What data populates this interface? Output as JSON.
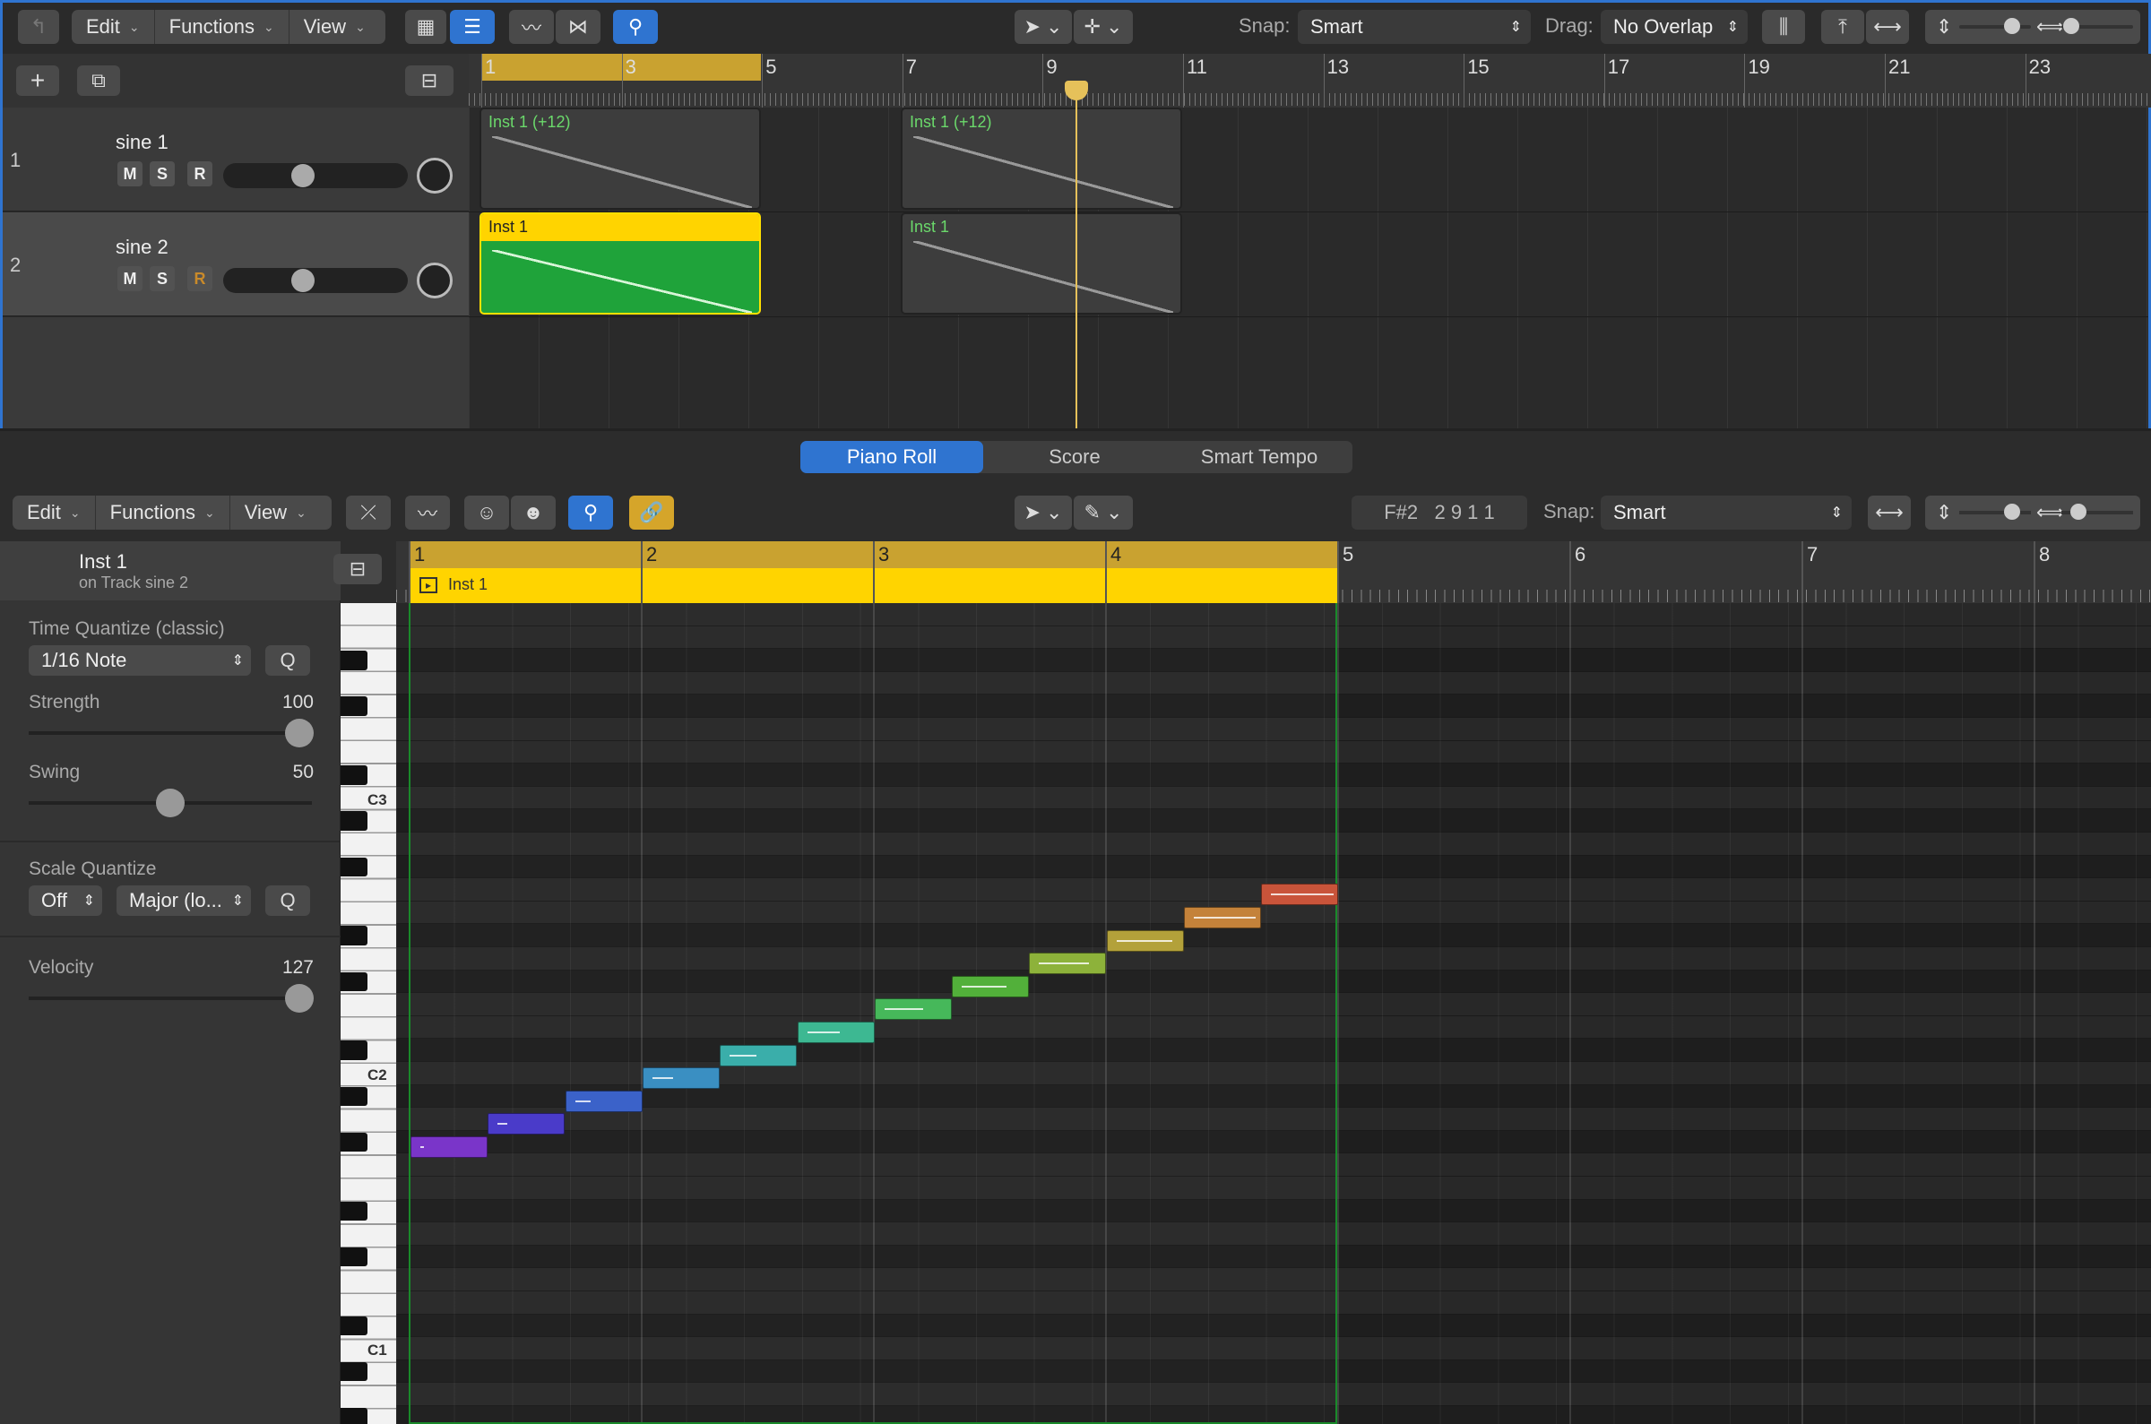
{
  "tracks_toolbar": {
    "edit": "Edit",
    "functions": "Functions",
    "view": "View",
    "snap_label": "Snap:",
    "snap_value": "Smart",
    "drag_label": "Drag:",
    "drag_value": "No Overlap"
  },
  "tracks": [
    {
      "number": "1",
      "name": "sine 1",
      "mute": "M",
      "solo": "S",
      "record": "R"
    },
    {
      "number": "2",
      "name": "sine 2",
      "mute": "M",
      "solo": "S",
      "record": "R"
    }
  ],
  "ruler_top": [
    "1",
    "3",
    "5",
    "7",
    "9",
    "11",
    "13",
    "15",
    "17",
    "19",
    "21",
    "23"
  ],
  "regions": [
    {
      "name": "Inst 1 (+12)"
    },
    {
      "name": "Inst 1 (+12)"
    },
    {
      "name": "Inst 1"
    },
    {
      "name": "Inst 1"
    }
  ],
  "editor_tabs": [
    "Piano Roll",
    "Score",
    "Smart Tempo"
  ],
  "pr_toolbar": {
    "edit": "Edit",
    "functions": "Functions",
    "view": "View",
    "position": "F#2   2 9 1 1",
    "snap_label": "Snap:",
    "snap_value": "Smart"
  },
  "inspector": {
    "region_name": "Inst 1",
    "region_track": "on Track sine 2",
    "time_quantize_label": "Time Quantize (classic)",
    "time_quantize_value": "1/16 Note",
    "q": "Q",
    "strength_label": "Strength",
    "strength_value": "100",
    "swing_label": "Swing",
    "swing_value": "50",
    "scale_quantize_label": "Scale Quantize",
    "scale_off": "Off",
    "scale_mode": "Major (lo...",
    "velocity_label": "Velocity",
    "velocity_value": "127"
  },
  "keys": {
    "c3": "C3",
    "c2": "C2",
    "c1": "C1"
  },
  "ruler_pr": [
    "1",
    "2",
    "3",
    "4",
    "5",
    "6",
    "7",
    "8"
  ],
  "pr_region_name": "Inst 1",
  "colors": {
    "accent": "#2f74d0",
    "region_selected": "#1fa33a",
    "ruler_gold": "#c9a230"
  },
  "notes": [
    {
      "color": "#7a35c9",
      "level": 0.0
    },
    {
      "color": "#4a3bc9",
      "level": 1
    },
    {
      "color": "#3b62c9",
      "level": 2
    },
    {
      "color": "#3a8fc2",
      "level": 3
    },
    {
      "color": "#3aaeaa",
      "level": 4
    },
    {
      "color": "#3db892",
      "level": 5
    },
    {
      "color": "#46b85a",
      "level": 6
    },
    {
      "color": "#52b03a",
      "level": 7
    },
    {
      "color": "#8db23a",
      "level": 8
    },
    {
      "color": "#b3a13a",
      "level": 9
    },
    {
      "color": "#c4823a",
      "level": 10
    },
    {
      "color": "#c9543a",
      "level": 11
    }
  ]
}
